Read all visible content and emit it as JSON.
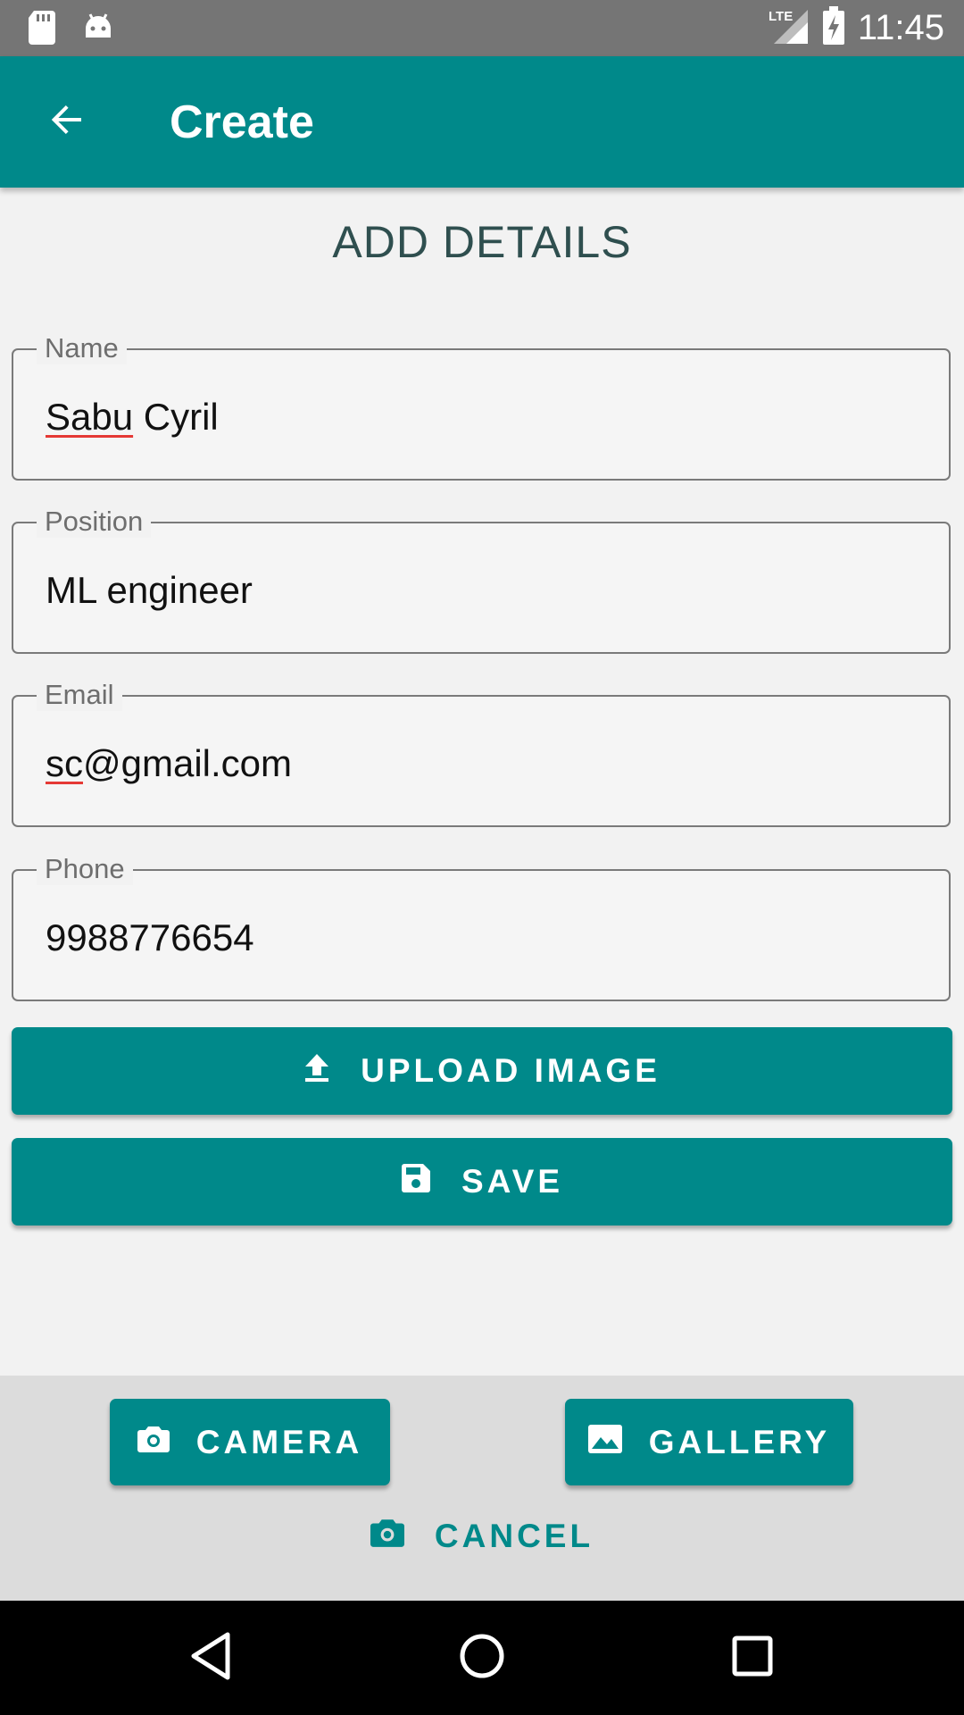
{
  "status_bar": {
    "time": "11:45",
    "network": "LTE",
    "icons": [
      "sd-card-icon",
      "android-icon",
      "lte-signal-icon",
      "battery-charging-icon"
    ]
  },
  "app_bar": {
    "title": "Create",
    "back_icon": "arrow-back-icon",
    "color": "#00898a"
  },
  "form": {
    "heading": "ADD DETAILS",
    "fields": [
      {
        "label": "Name",
        "value": "Sabu Cyril"
      },
      {
        "label": "Position",
        "value": "ML engineer"
      },
      {
        "label": "Email",
        "value": "sc@gmail.com"
      },
      {
        "label": "Phone",
        "value": "9988776654"
      }
    ],
    "upload_label": "UPLOAD IMAGE",
    "save_label": "SAVE"
  },
  "bottom_sheet": {
    "camera_label": "CAMERA",
    "gallery_label": "GALLERY",
    "cancel_label": "CANCEL"
  },
  "nav_bar": {
    "icons": [
      "back-triangle-icon",
      "home-circle-icon",
      "recents-square-icon"
    ]
  }
}
